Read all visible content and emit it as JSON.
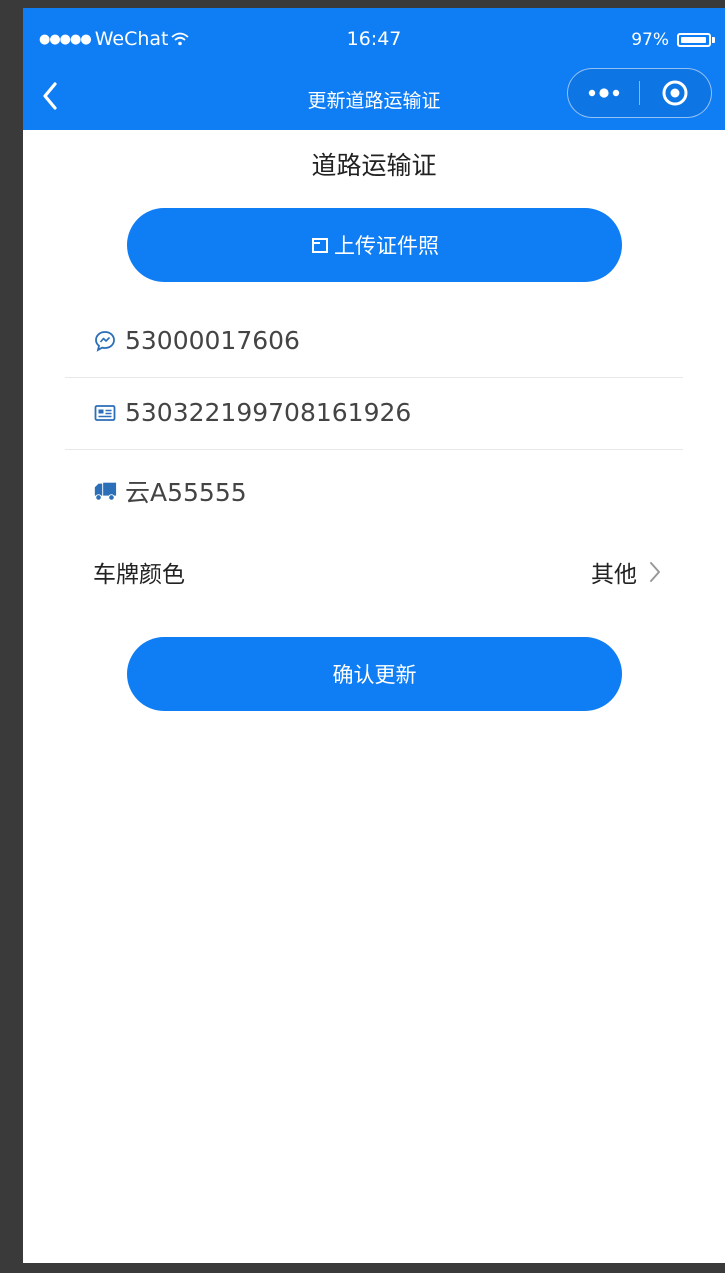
{
  "status_bar": {
    "carrier": "WeChat",
    "time": "16:47",
    "battery": "97%",
    "battery_level": 0.97
  },
  "nav": {
    "title": "更新道路运输证"
  },
  "page": {
    "title": "道路运输证"
  },
  "upload_button": {
    "label": "上传证件照",
    "icon": "upload-frame-icon"
  },
  "fields": [
    {
      "icon": "chat-bubble-icon",
      "value": "53000017606"
    },
    {
      "icon": "id-card-icon",
      "value": "530322199708161926"
    },
    {
      "icon": "truck-icon",
      "value": "云A55555"
    }
  ],
  "plate_color": {
    "label": "车牌颜色",
    "value": "其他"
  },
  "confirm_button": {
    "label": "确认更新"
  },
  "colors": {
    "brand": "#0f7df4",
    "frame": "#3a3a3a",
    "icon": "#2a6fb8"
  }
}
